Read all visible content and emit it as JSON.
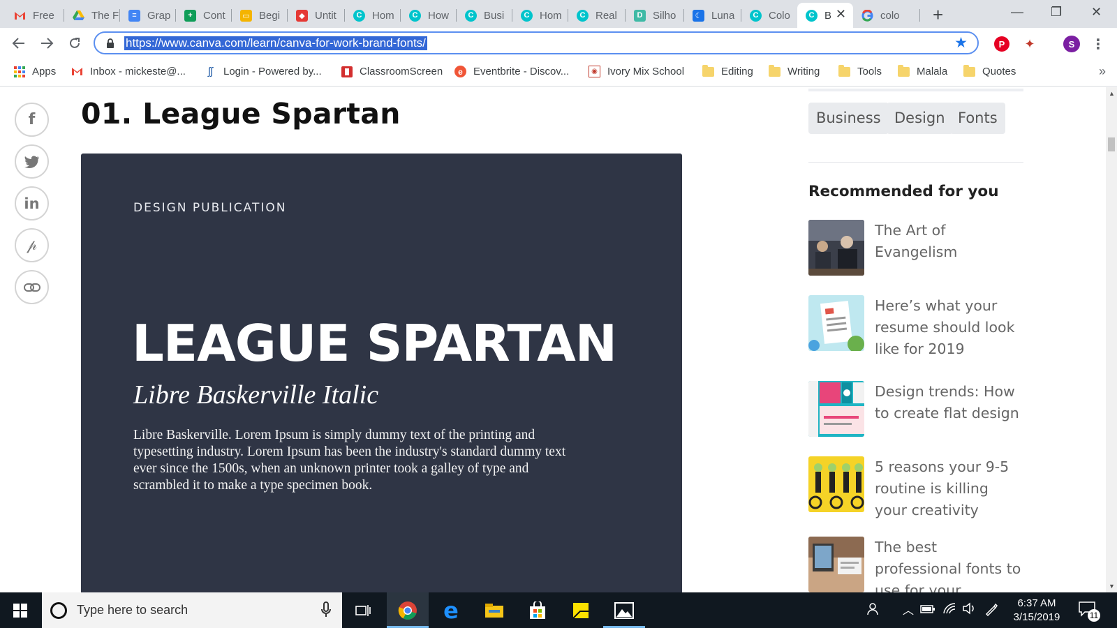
{
  "browser": {
    "tabs": [
      {
        "label": "Free",
        "favicon": "gmail-icon",
        "color": "#ea4335"
      },
      {
        "label": "The F",
        "favicon": "google-drive-icon",
        "color": "#34a853"
      },
      {
        "label": "Grap",
        "favicon": "google-docs-icon",
        "color": "#4285f4"
      },
      {
        "label": "Cont",
        "favicon": "google-sheets-icon",
        "color": "#0f9d58"
      },
      {
        "label": "Begi",
        "favicon": "google-slides-icon",
        "color": "#f4b400"
      },
      {
        "label": "Untit",
        "favicon": "app-icon",
        "color": "#e53935"
      },
      {
        "label": "Hom",
        "favicon": "canva-icon",
        "color": "#00c4cc"
      },
      {
        "label": "How",
        "favicon": "canva-icon",
        "color": "#00c4cc"
      },
      {
        "label": "Busi",
        "favicon": "canva-icon",
        "color": "#00c4cc"
      },
      {
        "label": "Hom",
        "favicon": "canva-icon",
        "color": "#00c4cc"
      },
      {
        "label": "Real",
        "favicon": "canva-icon",
        "color": "#00c4cc"
      },
      {
        "label": "Silho",
        "favicon": "silhouette-icon",
        "color": "#3fbaa6"
      },
      {
        "label": "Luna",
        "favicon": "luna-icon",
        "color": "#1a73e8"
      },
      {
        "label": "Colo",
        "favicon": "canva-icon",
        "color": "#00c4cc"
      },
      {
        "label": "B",
        "favicon": "canva-icon",
        "color": "#00c4cc",
        "active": true
      },
      {
        "label": "colo",
        "favicon": "google-icon",
        "color": "#4285f4"
      }
    ],
    "url": "https://www.canva.com/learn/canva-for-work-brand-fonts/",
    "profile_initial": "S",
    "bookmarks": [
      {
        "label": "Apps",
        "icon": "apps-grid-icon"
      },
      {
        "label": "Inbox - mickeste@...",
        "icon": "gmail-icon"
      },
      {
        "label": "Login - Powered by...",
        "icon": "login-icon"
      },
      {
        "label": "ClassroomScreen",
        "icon": "classroomscreen-icon"
      },
      {
        "label": "Eventbrite - Discov...",
        "icon": "eventbrite-icon"
      },
      {
        "label": "Ivory Mix School",
        "icon": "ivory-mix-icon"
      },
      {
        "label": "Editing",
        "icon": "folder-icon"
      },
      {
        "label": "Writing",
        "icon": "folder-icon"
      },
      {
        "label": "Tools",
        "icon": "folder-icon"
      },
      {
        "label": "Malala",
        "icon": "folder-icon"
      },
      {
        "label": "Quotes",
        "icon": "folder-icon"
      }
    ],
    "bookmarks_more": "»"
  },
  "article": {
    "heading": "01. League Spartan",
    "specimen": {
      "label": "DESIGN PUBLICATION",
      "title": "LEAGUE SPARTAN",
      "subtitle": "Libre Baskerville Italic",
      "body": "Libre Baskerville. Lorem Ipsum is simply dummy text of the printing and typesetting industry. Lorem Ipsum has been the industry's standard dummy text ever since the 1500s, when an unknown printer took a galley of type and scrambled it to make a type specimen book."
    },
    "share_icons": [
      "facebook-icon",
      "twitter-icon",
      "linkedin-icon",
      "pinterest-icon",
      "link-icon"
    ]
  },
  "sidebar": {
    "tags": [
      "Business",
      "Design",
      "Fonts"
    ],
    "recommended_heading": "Recommended for you",
    "recommended": [
      {
        "title": "The Art of Evangelism"
      },
      {
        "title": "Here’s what your resume should look like for 2019"
      },
      {
        "title": "Design trends: How to create flat design"
      },
      {
        "title": "5 reasons your 9-5 routine is killing your creativity"
      },
      {
        "title": "The best professional fonts to use for your"
      }
    ]
  },
  "taskbar": {
    "search_placeholder": "Type here to search",
    "time": "6:37 AM",
    "date": "3/15/2019",
    "notification_count": "11"
  },
  "colors": {
    "specimen_bg": "#2f3545",
    "accent": "#1a73e8",
    "url_selection": "#3367d6",
    "taskbar_bg": "#101820"
  }
}
